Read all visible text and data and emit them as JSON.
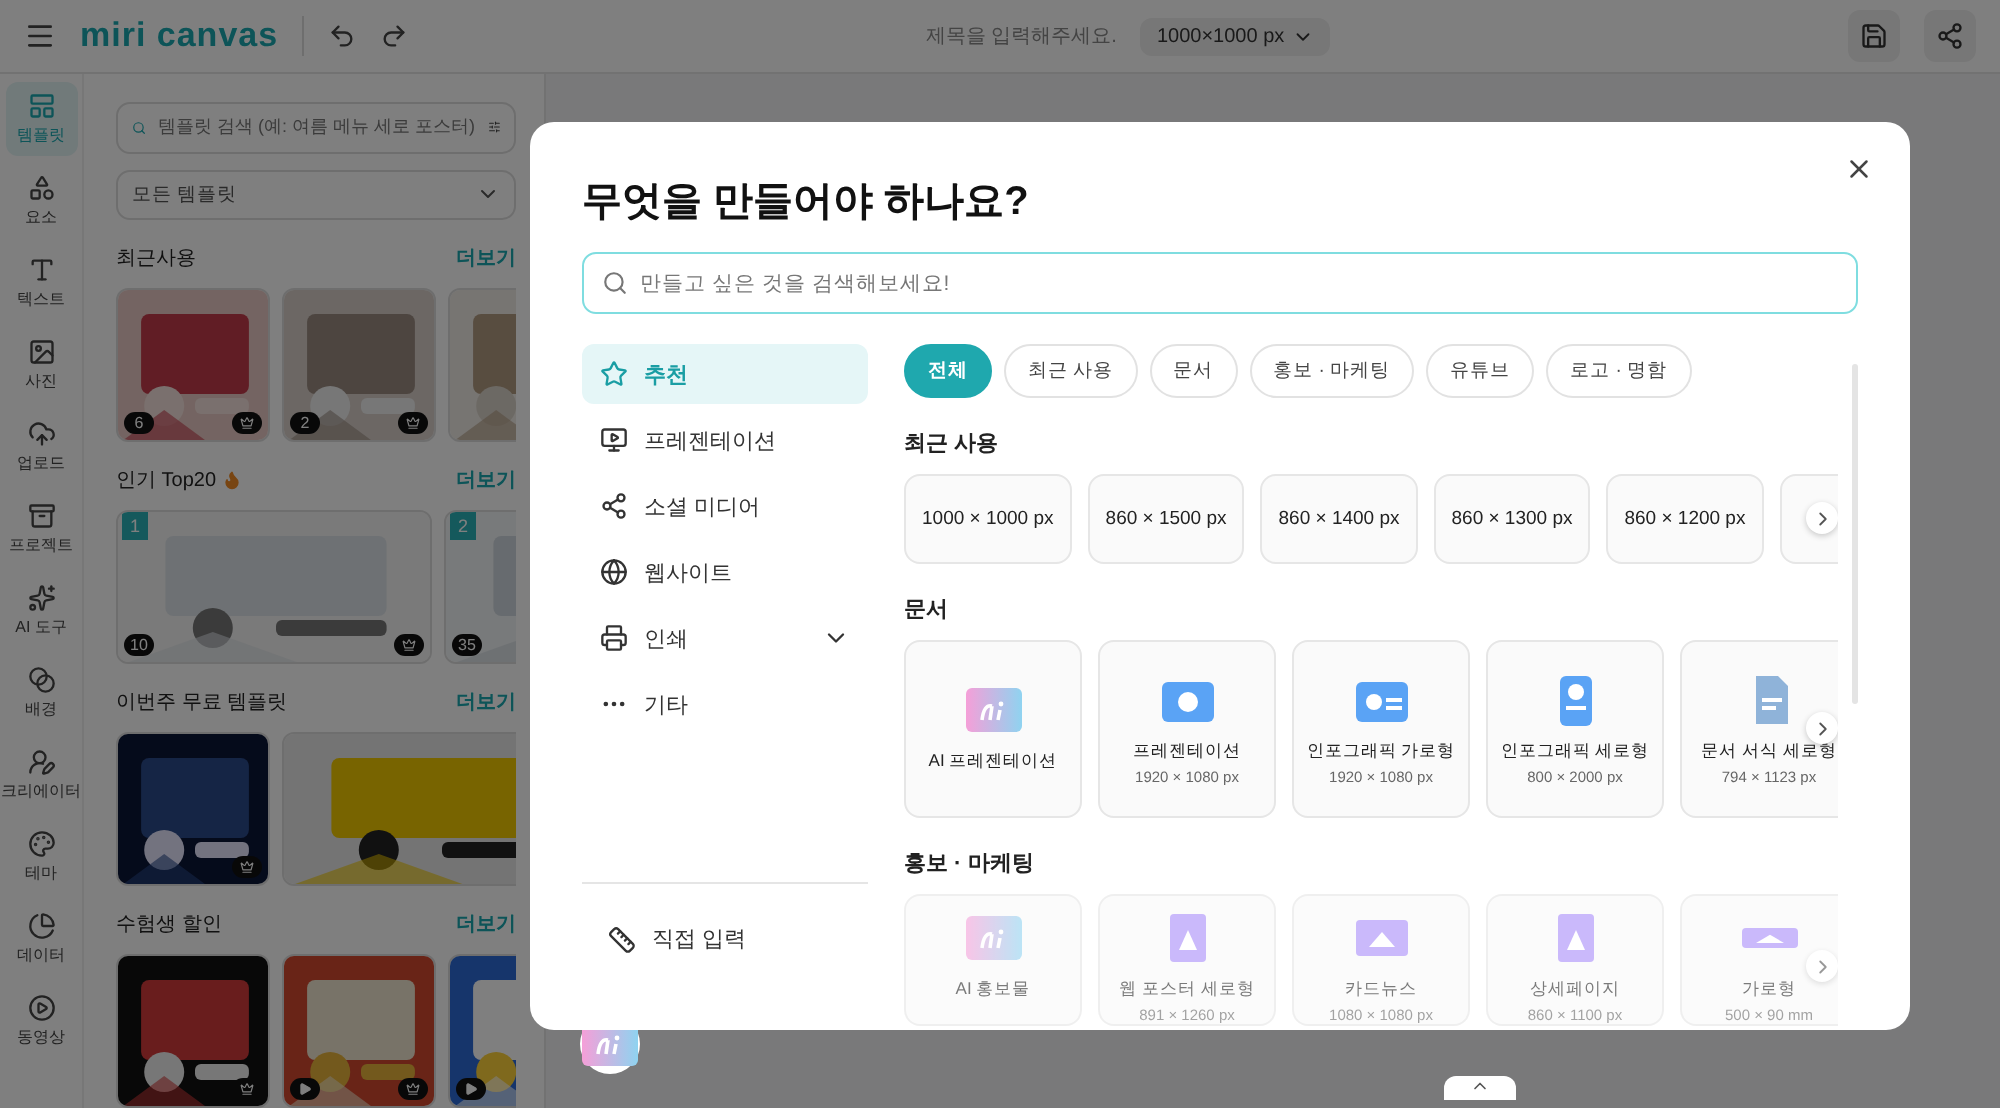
{
  "topbar": {
    "logo": "miri canvas",
    "title_placeholder": "제목을 입력해주세요.",
    "size": "1000×1000 px"
  },
  "rail": [
    {
      "label": "템플릿",
      "selected": true
    },
    {
      "label": "요소",
      "selected": false
    },
    {
      "label": "텍스트",
      "selected": false
    },
    {
      "label": "사진",
      "selected": false
    },
    {
      "label": "업로드",
      "selected": false
    },
    {
      "label": "프로젝트",
      "selected": false
    },
    {
      "label": "AI 도구",
      "selected": false
    },
    {
      "label": "배경",
      "selected": false
    },
    {
      "label": "크리에이터",
      "selected": false
    },
    {
      "label": "테마",
      "selected": false
    },
    {
      "label": "데이터",
      "selected": false
    },
    {
      "label": "동영상",
      "selected": false
    }
  ],
  "panel": {
    "search_placeholder": "템플릿 검색 (예: 여름 메뉴 세로 포스터)",
    "filter": "모든 템플릿",
    "sections": [
      {
        "title": "최근사용",
        "hot": false,
        "more": "더보기",
        "items": [
          {
            "kind": "square",
            "count": "6",
            "premium": true,
            "video": false
          },
          {
            "kind": "square",
            "count": "2",
            "premium": true,
            "video": false
          },
          {
            "kind": "square",
            "video": false
          }
        ]
      },
      {
        "title": "인기 Top20",
        "hot": true,
        "more": "더보기",
        "items": [
          {
            "kind": "wide",
            "rank": "1",
            "count": "10",
            "premium": true,
            "video": false
          },
          {
            "kind": "wide",
            "rank": "2",
            "count": "35",
            "video": false
          }
        ]
      },
      {
        "title": "이번주 무료 템플릿",
        "hot": false,
        "more": "더보기",
        "items": [
          {
            "kind": "square",
            "premium": true,
            "video": false
          },
          {
            "kind": "wide",
            "video": false
          }
        ]
      },
      {
        "title": "수험생 할인",
        "hot": false,
        "more": "더보기",
        "items": [
          {
            "kind": "square",
            "premium": true,
            "video": false
          },
          {
            "kind": "square",
            "premium": true,
            "video": true
          },
          {
            "kind": "square",
            "video": true
          }
        ]
      }
    ]
  },
  "modal": {
    "title": "무엇을 만들어야 하나요?",
    "search_placeholder": "만들고 싶은 것을 검색해보세요!",
    "nav": [
      {
        "label": "추천",
        "selected": true,
        "expandable": false
      },
      {
        "label": "프레젠테이션",
        "selected": false,
        "expandable": false
      },
      {
        "label": "소셜 미디어",
        "selected": false,
        "expandable": false
      },
      {
        "label": "웹사이트",
        "selected": false,
        "expandable": false
      },
      {
        "label": "인쇄",
        "selected": false,
        "expandable": true
      },
      {
        "label": "기타",
        "selected": false,
        "expandable": false
      }
    ],
    "custom": "직접 입력",
    "chips": [
      {
        "label": "전체",
        "selected": true
      },
      {
        "label": "최근 사용",
        "selected": false
      },
      {
        "label": "문서",
        "selected": false
      },
      {
        "label": "홍보 · 마케팅",
        "selected": false
      },
      {
        "label": "유튜브",
        "selected": false
      },
      {
        "label": "로고 · 명함",
        "selected": false
      }
    ],
    "recent": {
      "title": "최근 사용",
      "sizes": [
        "1000 × 1000 px",
        "860 × 1500 px",
        "860 × 1400 px",
        "860 × 1300 px",
        "860 × 1200 px"
      ]
    },
    "sections": [
      {
        "title": "문서",
        "dimmed": false,
        "cards": [
          {
            "name": "AI 프레젠테이션"
          },
          {
            "name": "프레젠테이션",
            "size": "1920 × 1080 px"
          },
          {
            "name": "인포그래픽 가로형",
            "size": "1920 × 1080 px"
          },
          {
            "name": "인포그래픽 세로형",
            "size": "800 × 2000 px"
          },
          {
            "name": "문서 서식 세로형",
            "size": "794 × 1123 px"
          }
        ]
      },
      {
        "title": "홍보 · 마케팅",
        "dimmed": true,
        "cards": [
          {
            "name": "AI 홍보물"
          },
          {
            "name": "웹 포스터 세로형",
            "size": "891 × 1260 px"
          },
          {
            "name": "카드뉴스",
            "size": "1080 × 1080 px"
          },
          {
            "name": "상세페이지",
            "size": "860 × 1100 px"
          },
          {
            "name": "가로형",
            "size": "500 × 90 mm"
          }
        ]
      }
    ]
  }
}
